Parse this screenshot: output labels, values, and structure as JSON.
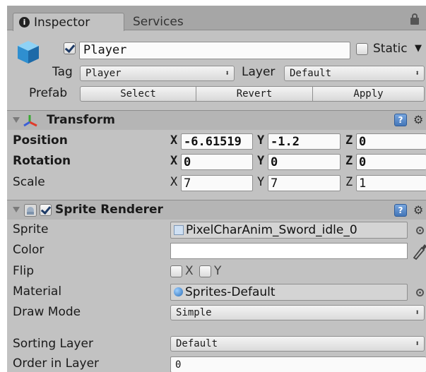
{
  "tabs": {
    "inspector": "Inspector",
    "services": "Services"
  },
  "object": {
    "name": "Player",
    "active": true,
    "static_label": "Static",
    "static_checked": false
  },
  "tag": {
    "label": "Tag",
    "value": "Player"
  },
  "layer": {
    "label": "Layer",
    "value": "Default"
  },
  "prefab": {
    "label": "Prefab",
    "select": "Select",
    "revert": "Revert",
    "apply": "Apply"
  },
  "transform": {
    "title": "Transform",
    "position": {
      "label": "Position",
      "x_label": "X",
      "y_label": "Y",
      "z_label": "Z",
      "x": "-6.61519",
      "y": "-1.2",
      "z": "0"
    },
    "rotation": {
      "label": "Rotation",
      "x_label": "X",
      "y_label": "Y",
      "z_label": "Z",
      "x": "0",
      "y": "0",
      "z": "0"
    },
    "scale": {
      "label": "Scale",
      "x_label": "X",
      "y_label": "Y",
      "z_label": "Z",
      "x": "7",
      "y": "7",
      "z": "1"
    }
  },
  "sprite_renderer": {
    "title": "Sprite Renderer",
    "enabled": true,
    "sprite": {
      "label": "Sprite",
      "value": "PixelCharAnim_Sword_idle_0"
    },
    "color": {
      "label": "Color",
      "value": "#ffffff"
    },
    "flip": {
      "label": "Flip",
      "x": "X",
      "y": "Y"
    },
    "material": {
      "label": "Material",
      "value": "Sprites-Default"
    },
    "draw_mode": {
      "label": "Draw Mode",
      "value": "Simple"
    },
    "sorting_layer": {
      "label": "Sorting Layer",
      "value": "Default"
    },
    "order_in_layer": {
      "label": "Order in Layer",
      "value": "0"
    }
  },
  "icons": {
    "tab": "info-icon",
    "lock": "lock-icon",
    "object": "cube-icon",
    "transform": "transform-axes-icon",
    "help": "help-icon",
    "settings": "gear-icon",
    "sprite_renderer": "sprite-renderer-icon",
    "object_picker": "object-picker-icon",
    "eyedropper": "eyedropper-icon"
  },
  "colors": {
    "panel": "#c2c2c2",
    "tabbar": "#a6a6a6",
    "section_header": "#b5b5b5",
    "accent": "#4476b8"
  }
}
